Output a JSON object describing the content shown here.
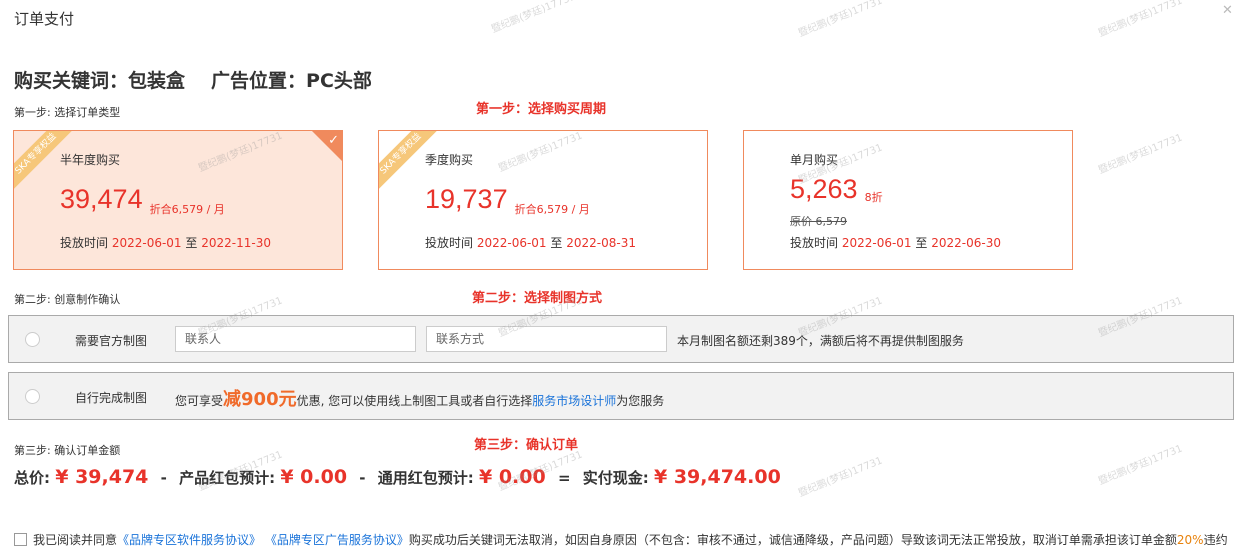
{
  "dialog": {
    "title": "订单支付"
  },
  "heading": {
    "keyword_label": "购买关键词：包装盒",
    "position_label": "广告位置：PC头部"
  },
  "steps": {
    "step1_label": "第一步: 选择订单类型",
    "step2_label": "第二步: 创意制作确认",
    "step3_label": "第三步: 确认订单金额"
  },
  "annotations": {
    "a1": "第一步：选择购买周期",
    "a2": "第二步：选择制图方式",
    "a3": "第三步：确认订单"
  },
  "cards": [
    {
      "ribbon": "SKA专享权益",
      "title": "半年度购买",
      "price": "39,474",
      "monthly": "折合6,579 / 月",
      "time_prefix": "投放时间 ",
      "start": "2022-06-01",
      "sep": " 至 ",
      "end": "2022-11-30",
      "selected": true
    },
    {
      "ribbon": "SKA专享权益",
      "title": "季度购买",
      "price": "19,737",
      "monthly": "折合6,579 / 月",
      "time_prefix": "投放时间 ",
      "start": "2022-06-01",
      "sep": " 至 ",
      "end": "2022-08-31",
      "selected": false
    },
    {
      "title": "单月购买",
      "price": "5,263",
      "discount": "8折",
      "orig_price": "原价 6,579",
      "time_prefix": "投放时间 ",
      "start": "2022-06-01",
      "sep": " 至 ",
      "end": "2022-06-30",
      "selected": false
    }
  ],
  "design_options": {
    "official": {
      "label": "需要官方制图",
      "contact_placeholder": "联系人",
      "phone_placeholder": "联系方式",
      "note": "本月制图名额还剩389个，满额后将不再提供制图服务"
    },
    "self": {
      "label": "自行完成制图",
      "promo_prefix": "您可享受",
      "promo_amount": "减900元",
      "promo_middle": "优惠, 您可以使用线上制图工具或者自行选择",
      "promo_link": "服务市场设计师",
      "promo_suffix": "为您服务"
    }
  },
  "totals": {
    "total_label": "总价:",
    "total_value": "¥ 39,474",
    "minus1": "-",
    "product_label": "产品红包预计:",
    "product_value": "¥ 0.00",
    "minus2": "-",
    "general_label": "通用红包预计:",
    "general_value": "¥ 0.00",
    "equals": "=",
    "cash_label": "实付现金:",
    "cash_value": "¥ 39,474.00"
  },
  "agreement": {
    "prefix": "我已阅读并同意",
    "link1": "《品牌专区软件服务协议》",
    "link2": "《品牌专区广告服务协议》",
    "middle": "购买成功后关键词无法取消，如因自身原因（不包含：审核不通过，诚信通降级，产品问题）导致该词无法正常投放，取消订单需承担该订单金额",
    "percent": "20%",
    "suffix": "违约"
  },
  "watermark": {
    "text": "暨纪鹏(梦廷)17731"
  },
  "colors": {
    "accent": "#e8332a",
    "card_border": "#f08a5d",
    "selected_bg": "#fde6da",
    "link": "#1a73d9",
    "ribbon": "#f6c77a"
  }
}
